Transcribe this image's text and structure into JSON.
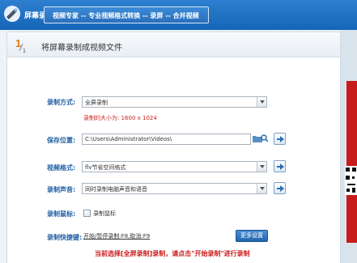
{
  "app": {
    "title": "屏幕录制",
    "banner_text": "视频专家 -- 专业视频格式转换 -- 录屏 -- 合并视频"
  },
  "step": {
    "number": "1/1",
    "title": "将屏幕录制成视频文件"
  },
  "form": {
    "record_mode_label": "录制方式:",
    "record_mode_value": "全屏录制",
    "resolution_text": "录制的大小为: 1600 x 1024",
    "save_location_label": "保存位置:",
    "save_location_value": "C:\\Users\\Administrator\\Videos\\",
    "video_format_label": "视频格式:",
    "video_format_value": "flv节省空间格式",
    "audio_label": "录制声音:",
    "audio_value": "同时录制电脑声音和语音",
    "cursor_label": "录制鼠标:",
    "cursor_checkbox_label": "录制鼠标",
    "hotkey_label": "录制快捷键:",
    "hotkey_value": "开始/暂停录制:F8,取消:F9",
    "more_settings_button": "更多设置"
  },
  "status": {
    "bottom_message": "当前选择[全屏录制]录制，请点击\"开始录制\"进行录制"
  },
  "colors": {
    "header_blue": "#1f6fc0",
    "label_blue": "#1f5ea3",
    "alert_red": "#cc1b1b"
  }
}
